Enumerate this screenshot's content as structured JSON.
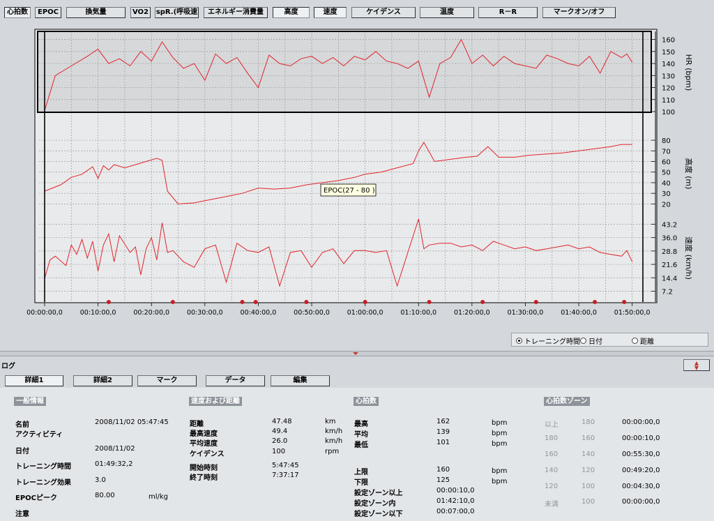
{
  "toolbar": {
    "buttons": [
      {
        "label": "心拍数",
        "active": true
      },
      {
        "label": "EPOC",
        "active": false
      },
      {
        "label": "換気量",
        "active": false
      },
      {
        "label": "VO2",
        "active": false
      },
      {
        "label": "spR.(呼吸速",
        "active": false
      },
      {
        "label": "エネルギー消費量",
        "active": false
      },
      {
        "label": "高度",
        "active": true
      },
      {
        "label": "速度",
        "active": true
      },
      {
        "label": "ケイデンス",
        "active": false
      },
      {
        "label": "温度",
        "active": false
      },
      {
        "label": "R－R",
        "active": false
      },
      {
        "label": "マークオン/オフ",
        "active": false
      }
    ]
  },
  "chart_data": [
    {
      "type": "line",
      "series": [
        {
          "name": "HR",
          "x_min": [
            0,
            2,
            5,
            8,
            10,
            12,
            14,
            16,
            18,
            20,
            22,
            24,
            26,
            28,
            30,
            32,
            34,
            36,
            38,
            40,
            42,
            44,
            46,
            48,
            50,
            52,
            54,
            56,
            58,
            60,
            62,
            64,
            66,
            68,
            70,
            72,
            74,
            76,
            78,
            80,
            82,
            84,
            86,
            88,
            90,
            92,
            94,
            96,
            98,
            100,
            102,
            104,
            106,
            108,
            109,
            110
          ],
          "values": [
            101,
            130,
            138,
            146,
            152,
            140,
            144,
            138,
            150,
            142,
            158,
            145,
            136,
            140,
            126,
            148,
            140,
            145,
            132,
            120,
            147,
            140,
            138,
            144,
            146,
            140,
            145,
            138,
            146,
            143,
            150,
            142,
            140,
            136,
            142,
            112,
            140,
            145,
            160,
            140,
            147,
            138,
            146,
            140,
            138,
            136,
            147,
            144,
            140,
            138,
            146,
            132,
            150,
            145,
            148,
            141
          ]
        }
      ],
      "ylabel": "HR (bpm)",
      "ylim": [
        100,
        165
      ],
      "ticks": [
        100,
        110,
        120,
        130,
        140,
        150,
        160
      ]
    },
    {
      "type": "line",
      "series": [
        {
          "name": "高度",
          "x_min": [
            0,
            3,
            5,
            7,
            9,
            10,
            11,
            12,
            13,
            15,
            17,
            19,
            21,
            22,
            23,
            25,
            28,
            31,
            34,
            37,
            40,
            43,
            46,
            49,
            52,
            55,
            58,
            60,
            63,
            66,
            69,
            70,
            71,
            73,
            76,
            79,
            81,
            83,
            85,
            88,
            91,
            94,
            97,
            100,
            103,
            106,
            108,
            110
          ],
          "values": [
            32,
            38,
            45,
            48,
            55,
            44,
            56,
            52,
            57,
            54,
            57,
            60,
            63,
            61,
            32,
            20,
            21,
            24,
            27,
            30,
            35,
            34,
            35,
            38,
            40,
            42,
            45,
            48,
            50,
            54,
            58,
            70,
            78,
            60,
            62,
            64,
            65,
            74,
            64,
            64,
            66,
            67,
            68,
            70,
            72,
            74,
            76,
            76
          ]
        }
      ],
      "ylabel": "高度 (m)",
      "ylim": [
        15,
        82
      ],
      "ticks": [
        20,
        30,
        40,
        50,
        60,
        70,
        80
      ]
    },
    {
      "type": "line",
      "series": [
        {
          "name": "速度",
          "x_min": [
            0,
            1,
            2,
            4,
            5,
            6,
            7,
            8,
            9,
            10,
            11,
            12,
            13,
            14,
            16,
            17,
            18,
            19,
            20,
            21,
            22,
            23,
            24,
            26,
            28,
            30,
            32,
            34,
            36,
            38,
            40,
            42,
            44,
            46,
            48,
            50,
            52,
            54,
            56,
            58,
            60,
            62,
            64,
            66,
            68,
            70,
            71,
            72,
            74,
            76,
            78,
            80,
            82,
            84,
            86,
            88,
            90,
            92,
            94,
            96,
            98,
            100,
            102,
            104,
            106,
            108,
            109,
            110
          ],
          "values": [
            14,
            24,
            26,
            21,
            32,
            27,
            35,
            25,
            34,
            18,
            32,
            38,
            23,
            37,
            28,
            31,
            16,
            30,
            36,
            24,
            44,
            28,
            29,
            23,
            20,
            30,
            32,
            12,
            33,
            29,
            28,
            31,
            10,
            28,
            29,
            20,
            28,
            30,
            22,
            29,
            29,
            28,
            29,
            10,
            28,
            46,
            30,
            32,
            33,
            33,
            31,
            32,
            29,
            34,
            32,
            30,
            31,
            29,
            30,
            31,
            32,
            30,
            31,
            28,
            27,
            26,
            29,
            23
          ]
        }
      ],
      "ylabel": "速度 (km/h)",
      "ylim": [
        4,
        46
      ],
      "ticks": [
        7.2,
        14.4,
        21.6,
        28.8,
        36.0,
        43.2
      ]
    }
  ],
  "x_axis": {
    "ticks": [
      "00:00:00,0",
      "00:10:00,0",
      "00:20:00,0",
      "00:30:00,0",
      "00:40:00,0",
      "00:50:00,0",
      "01:00:00,0",
      "01:10:00,0",
      "01:20:00,0",
      "01:30:00,0",
      "01:40:00,0",
      "01:50:00,0"
    ],
    "range_min": [
      0,
      112
    ],
    "marks_min": [
      12,
      24,
      37,
      39.5,
      49,
      60,
      72,
      82,
      92,
      103,
      108.5
    ]
  },
  "tooltip": "EPOC(27 - 80 )",
  "radio": {
    "options": [
      {
        "label": "トレーニング時間",
        "selected": true
      },
      {
        "label": "日付",
        "selected": false
      },
      {
        "label": "距離",
        "selected": false
      }
    ]
  },
  "log": {
    "title": "ログ",
    "tabs": [
      {
        "label": "詳細1",
        "active": true
      },
      {
        "label": "詳細2",
        "active": false
      },
      {
        "label": "マーク",
        "active": false
      },
      {
        "label": "データ",
        "active": false
      },
      {
        "label": "編集",
        "active": false
      }
    ]
  },
  "general": {
    "title": "一般情報",
    "name_label": "名前",
    "name_value": "2008/11/02 05:47:45",
    "activity_label": "アクティビティ",
    "date_label": "日付",
    "date_value": "2008/11/02",
    "training_time_label": "トレーニング時間",
    "training_time_value": "01:49:32,2",
    "training_effect_label": "トレーニング効果",
    "training_effect_value": "3.0",
    "epoc_peak_label": "EPOCピーク",
    "epoc_peak_value": "80.00",
    "epoc_peak_unit": "ml/kg",
    "note_label": "注意"
  },
  "speed": {
    "title": "速度および距離",
    "distance_label": "距離",
    "distance_value": "47.48",
    "distance_unit": "km",
    "max_speed_label": "最高速度",
    "max_speed_value": "49.4",
    "max_speed_unit": "km/h",
    "avg_speed_label": "平均速度",
    "avg_speed_value": "26.0",
    "avg_speed_unit": "km/h",
    "cadence_label": "ケイデンス",
    "cadence_value": "100",
    "cadence_unit": "rpm",
    "start_label": "開始時刻",
    "start_value": "5:47:45",
    "end_label": "終了時刻",
    "end_value": "7:37:17"
  },
  "hr": {
    "title": "心拍数",
    "max_label": "最高",
    "max_value": "162",
    "max_unit": "bpm",
    "avg_label": "平均",
    "avg_value": "139",
    "avg_unit": "bpm",
    "min_label": "最低",
    "min_value": "101",
    "min_unit": "bpm",
    "upper_label": "上限",
    "upper_value": "160",
    "upper_unit": "bpm",
    "lower_label": "下限",
    "lower_value": "125",
    "lower_unit": "bpm",
    "above_label": "設定ゾーン以上",
    "above_value": "00:00:10,0",
    "in_label": "設定ゾーン内",
    "in_value": "01:42:10,0",
    "below_label": "設定ゾーン以下",
    "below_value": "00:07:00,0"
  },
  "zones": {
    "title": "心拍数ゾーン",
    "rows": [
      {
        "a": "以上",
        "b": "180",
        "t": "00:00:00,0"
      },
      {
        "a": "180",
        "b": "160",
        "t": "00:00:10,0"
      },
      {
        "a": "160",
        "b": "140",
        "t": "00:55:30,0"
      },
      {
        "a": "140",
        "b": "120",
        "t": "00:49:20,0"
      },
      {
        "a": "120",
        "b": "100",
        "t": "00:04:30,0"
      },
      {
        "a": "未満",
        "b": "100",
        "t": "00:00:00,0"
      }
    ]
  },
  "colors": {
    "line": "#e0242c",
    "marker": "#c81e24",
    "hr_band": "#d6d8da",
    "plot_bg": "#ececec"
  }
}
